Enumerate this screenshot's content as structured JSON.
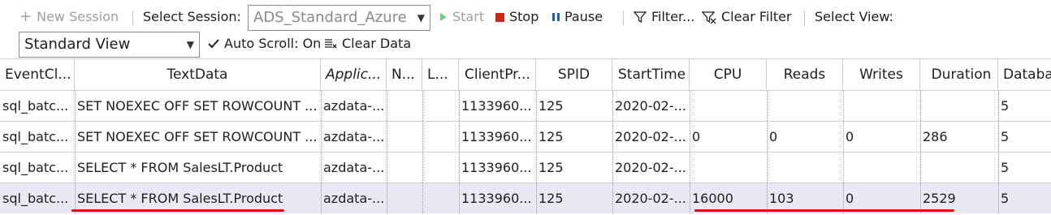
{
  "toolbar": {
    "new_session": "New Session",
    "select_session_label": "Select Session:",
    "session_value": "ADS_Standard_Azure",
    "start": "Start",
    "stop": "Stop",
    "pause": "Pause",
    "filter": "Filter...",
    "clear_filter": "Clear Filter",
    "select_view_label": "Select View:",
    "view_value": "Standard View",
    "auto_scroll": "Auto Scroll: On",
    "clear_data": "Clear Data"
  },
  "columns": [
    "EventCl...",
    "TextData",
    "Applic...",
    "N...",
    "L...",
    "ClientPr...",
    "SPID",
    "StartTime",
    "CPU",
    "Reads",
    "Writes",
    "Duration",
    "Database"
  ],
  "rows": [
    [
      "sql_batc...",
      "SET NOEXEC OFF SET ROWCOUNT ...",
      "azdata-...",
      "",
      "",
      "1133960...",
      "125",
      "2020-02-...",
      "",
      "",
      "",
      "",
      "5"
    ],
    [
      "sql_batc...",
      "SET NOEXEC OFF SET ROWCOUNT ...",
      "azdata-...",
      "",
      "",
      "1133960...",
      "125",
      "2020-02-...",
      "0",
      "0",
      "0",
      "286",
      "5"
    ],
    [
      "sql_batc...",
      "SELECT * FROM SalesLT.Product",
      "azdata-...",
      "",
      "",
      "1133960...",
      "125",
      "2020-02-...",
      "",
      "",
      "",
      "",
      "5"
    ],
    [
      "sql_batc...",
      "SELECT * FROM SalesLT.Product",
      "azdata-...",
      "",
      "",
      "1133960...",
      "125",
      "2020-02-...",
      "16000",
      "103",
      "0",
      "2529",
      "5"
    ]
  ],
  "selected_row": 3,
  "colors": {
    "stop": "#c42b1c",
    "accent": "#1f5fa8",
    "selected_row": "#e8e9f4",
    "annotation": "#e01010"
  },
  "icons": {
    "new_session": "plus-icon",
    "start": "play-icon",
    "stop": "stop-icon",
    "pause": "pause-icon",
    "filter": "filter-icon",
    "clear_filter": "clear-filter-icon",
    "auto_scroll": "checkmark-icon",
    "clear_data": "clear-data-icon"
  }
}
